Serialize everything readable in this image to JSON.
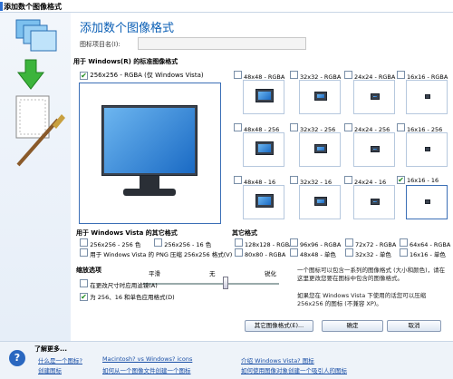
{
  "window": {
    "title": "添加数个图像格式"
  },
  "header": {
    "title": "添加数个图像格式"
  },
  "name_field": {
    "label": "图标项目名(I):",
    "value": ""
  },
  "standard": {
    "section": "用于 Windows(R) 的标准图像格式",
    "main_label": "256x256 - RGBA (仅 Windows Vista)",
    "cells": [
      {
        "label": "48x48 - RGBA",
        "checked": false
      },
      {
        "label": "32x32 - RGBA",
        "checked": false
      },
      {
        "label": "24x24 - RGBA",
        "checked": false
      },
      {
        "label": "16x16 - RGBA",
        "checked": false
      },
      {
        "label": "48x48 - 256",
        "checked": false
      },
      {
        "label": "32x32 - 256",
        "checked": false
      },
      {
        "label": "24x24 - 256",
        "checked": false
      },
      {
        "label": "16x16 - 256",
        "checked": false
      },
      {
        "label": "48x48 - 16",
        "checked": false
      },
      {
        "label": "32x32 - 16",
        "checked": false
      },
      {
        "label": "24x24 - 16",
        "checked": false
      },
      {
        "label": "16x16 - 16",
        "checked": true
      }
    ]
  },
  "vista": {
    "section": "用于 Windows Vista 的其它格式",
    "opt1": "256x256 - 256 色",
    "opt2": "256x256 - 16 色",
    "opt3": "用于 Windows Vista 的 PNG 压缩 256x256 格式(V)"
  },
  "other": {
    "section": "其它格式",
    "items": [
      "128x128 - RGBA",
      "96x96 - RGBA",
      "72x72 - RGBA",
      "64x64 - RGBA",
      "80x80 - RGBA",
      "48x48 - 单色",
      "32x32 - 单色",
      "16x16 - 单色"
    ]
  },
  "info": {
    "text1": "一个图标可以包含一系列的图像格式 (大小和颜色)，请在这里更改您要在图标中包含的图像格式。",
    "text2": "如果您在 Windows Vista 下使用的话您可以压缩 256x256 的图标 (不兼容 XP)。"
  },
  "shrink": {
    "section": "缩放选项",
    "opt1": "在更改尺寸时应用滤镜(A)",
    "opt2": "为 256、16 和单色应用格式(D)",
    "slider_labels": [
      "平滑",
      "无",
      "锐化"
    ]
  },
  "buttons": {
    "other": "其它图像格式(E)...",
    "ok": "确定",
    "cancel": "取消"
  },
  "footer": {
    "title": "了解更多...",
    "links": [
      "什么是一个图标?",
      "Macintosh? vs Windows? icons",
      "介绍 Windows Vista? 图标",
      "创建图标",
      "如何从一个图像文件创建一个图标",
      "如何使用图像对象创建一个吸引人的图标"
    ]
  }
}
